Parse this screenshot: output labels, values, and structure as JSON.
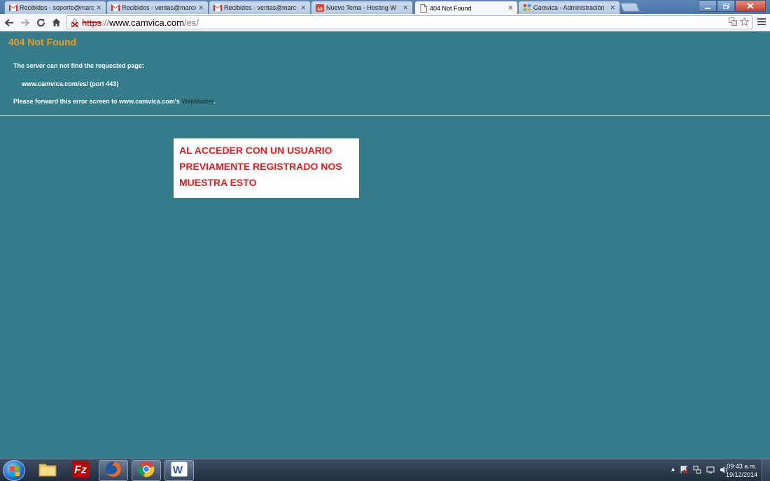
{
  "browser": {
    "tabs": [
      {
        "label": "Recibidos - soporte@marc",
        "icon": "gmail-icon",
        "active": false
      },
      {
        "label": "Recibidos - ventas@marcx",
        "icon": "gmail-icon",
        "active": false
      },
      {
        "label": "Recibidos - ventas@marc",
        "icon": "gmail-icon",
        "active": false
      },
      {
        "label": "Nuevo Tema - Hosting W",
        "icon": "forum-icon",
        "active": false
      },
      {
        "label": "404 Not Found",
        "icon": "page-icon",
        "active": true
      },
      {
        "label": "Camvica - Administración",
        "icon": "joomla-icon",
        "active": false
      }
    ],
    "close_glyph": "✕",
    "address": {
      "scheme": "https",
      "separator": "://",
      "host": "www.camvica.com",
      "path": "/es/"
    }
  },
  "page": {
    "title": "404 Not Found",
    "message": "The server can not find the requested page:",
    "requested_url": "www.camvica.com/es/ (port 443)",
    "forward_prefix": "Please forward this error screen to www.camvica.com's",
    "webmaster_link": "WebMaster",
    "forward_suffix": ".",
    "title_color": "#f49b1b",
    "background_color": "#367d8c"
  },
  "annotation": {
    "line1": "AL ACCEDER CON UN USUARIO",
    "line2": "PREVIAMENTE REGISTRADO NOS",
    "line3": "MUESTRA ESTO",
    "color": "#e02020"
  },
  "taskbar": {
    "apps": [
      "windows-explorer-icon",
      "filezilla-icon",
      "firefox-icon",
      "chrome-icon",
      "word-icon"
    ],
    "clock_time": "09:43 a.m.",
    "clock_date": "19/12/2014"
  }
}
